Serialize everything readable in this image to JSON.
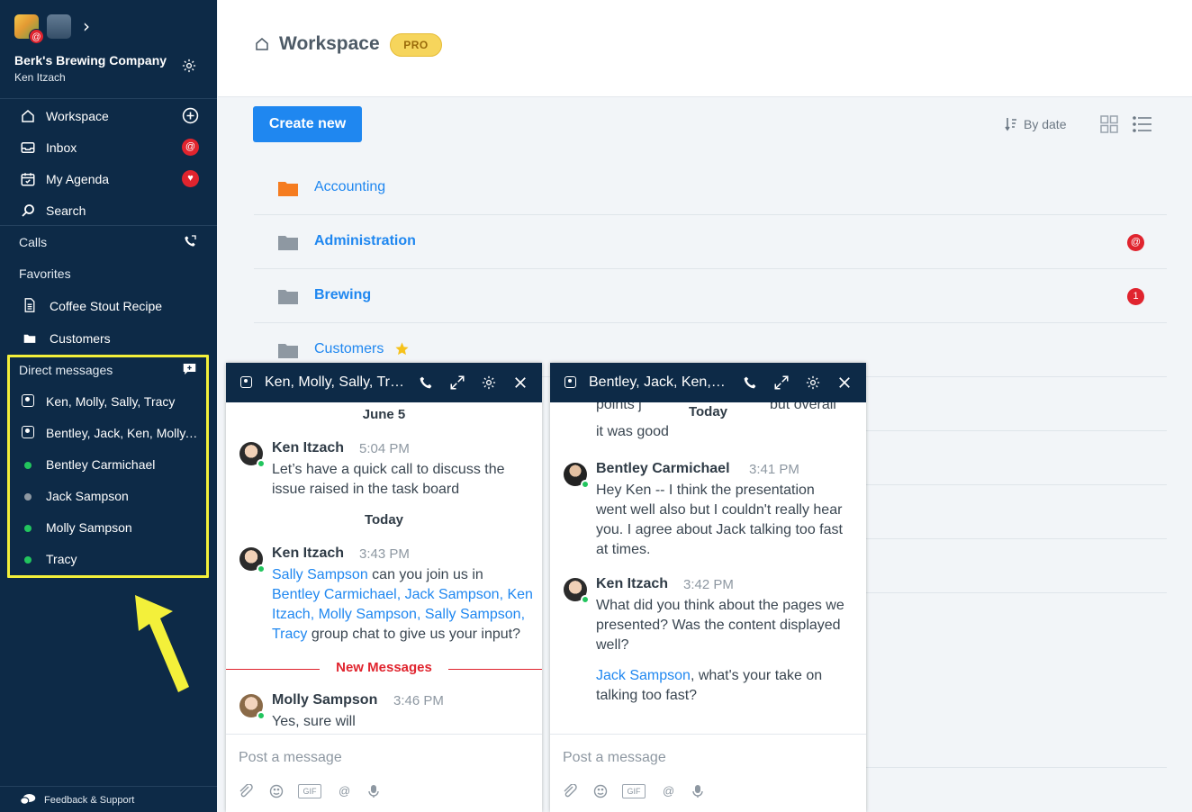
{
  "sidebar": {
    "company": "Berk's Brewing Company",
    "user": "Ken Itzach",
    "app_badge": "@",
    "nav": [
      {
        "label": "Workspace",
        "icon": "home-icon"
      },
      {
        "label": "Inbox",
        "icon": "inbox-icon",
        "badge": "@"
      },
      {
        "label": "My Agenda",
        "icon": "calendar-icon",
        "badge": "♥"
      },
      {
        "label": "Search",
        "icon": "search-icon"
      }
    ],
    "calls_label": "Calls",
    "favorites_label": "Favorites",
    "favorites": [
      {
        "label": "Coffee Stout Recipe",
        "icon": "document-icon"
      },
      {
        "label": "Customers",
        "icon": "folder-icon"
      }
    ],
    "dm_label": "Direct messages",
    "direct_messages": [
      {
        "label": "Ken, Molly, Sally, Tracy",
        "type": "group"
      },
      {
        "label": "Bentley, Jack, Ken, Molly, Sally, Tracy",
        "type": "group"
      },
      {
        "label": "Bentley Carmichael",
        "status": "online",
        "color": "#22c55e"
      },
      {
        "label": "Jack Sampson",
        "status": "away",
        "color": "#8e98a2"
      },
      {
        "label": "Molly Sampson",
        "status": "online",
        "color": "#22c55e"
      },
      {
        "label": "Tracy",
        "status": "online",
        "color": "#22c55e"
      }
    ],
    "feedback": "Feedback & Support"
  },
  "header": {
    "title": "Workspace",
    "badge": "PRO"
  },
  "toolbar": {
    "create_label": "Create new",
    "sort_label": "By date"
  },
  "folders": [
    {
      "label": "Accounting",
      "color": "#f57c20",
      "bold": false
    },
    {
      "label": "Administration",
      "color": "#8e98a2",
      "bold": true,
      "badge": "@"
    },
    {
      "label": "Brewing",
      "color": "#8e98a2",
      "bold": true,
      "badge": "1"
    },
    {
      "label": "Customers",
      "color": "#8e98a2",
      "bold": false,
      "starred": true
    }
  ],
  "chat1": {
    "title": "Ken, Molly, Sally, Tracy",
    "day1": "June 5",
    "msg1": {
      "name": "Ken Itzach",
      "time": "5:04 PM",
      "text": "Let’s have a quick call to discuss the issue raised in the task board"
    },
    "day2": "Today",
    "msg2": {
      "name": "Ken Itzach",
      "time": "3:43 PM",
      "mention1": "Sally Sampson",
      "text1": " can you join us in ",
      "mention2": "Bentley Carmichael",
      "sep1": ", ",
      "mention3": "Jack Sampson",
      "sep2": ", ",
      "mention4": "Ken Itzach",
      "sep3": ", ",
      "mention5": "Molly Sampson",
      "sep4": ", ",
      "mention6": "Sally Sampson",
      "sep5": ", ",
      "mention7": "Tracy",
      "text2": " group chat to give us your input?"
    },
    "new_messages": "New Messages",
    "msg3": {
      "name": "Molly Sampson",
      "time": "3:46 PM",
      "text": "Yes, sure will"
    },
    "placeholder": "Post a message",
    "gif": "GIF",
    "at": "@"
  },
  "chat2": {
    "title": "Bentley, Jack, Ken, Molly, Sally, Tracy",
    "partial_left": "points j",
    "partial_right": "but overall",
    "partial_line2": "it was good",
    "day": "Today",
    "msg1": {
      "name": "Bentley Carmichael",
      "time": "3:41 PM",
      "text": "Hey Ken -- I think the presentation went well also but I couldn't really hear you. I agree about Jack talking too fast at times."
    },
    "msg2": {
      "name": "Ken Itzach",
      "time": "3:42 PM",
      "text": "What did you think about the pages we presented? Was the content displayed well?",
      "mention": "Jack Sampson",
      "text2": ", what's your take on talking too fast?"
    },
    "placeholder": "Post a message",
    "gif": "GIF",
    "at": "@"
  }
}
